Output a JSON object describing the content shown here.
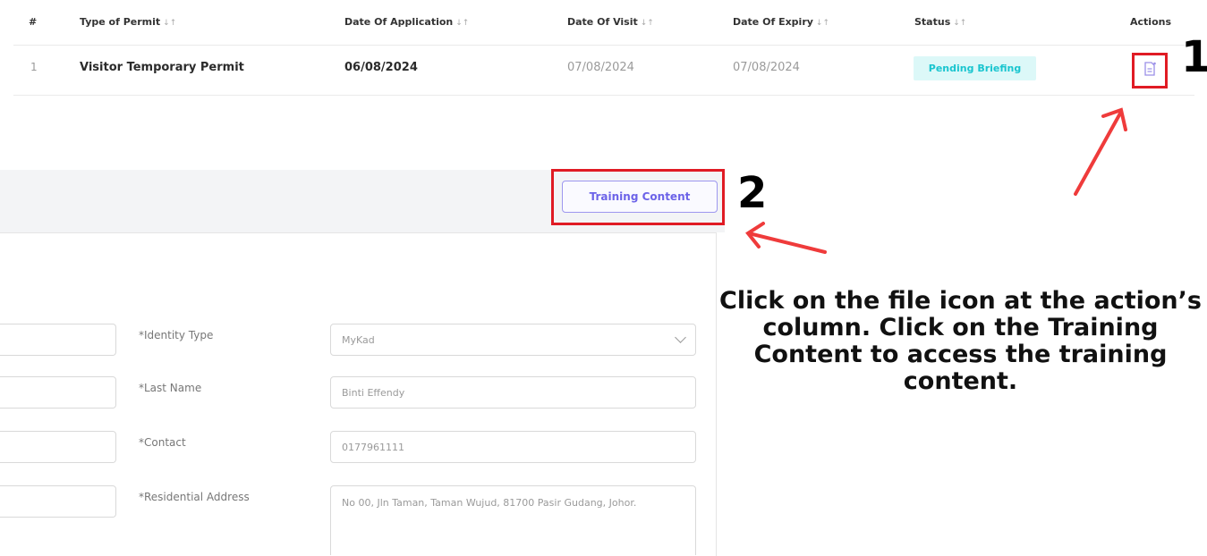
{
  "table": {
    "headers": [
      {
        "label": "#",
        "sort": ""
      },
      {
        "label": "Type of Permit",
        "sort": "↓↑"
      },
      {
        "label": "Date Of Application",
        "sort": "↓↑"
      },
      {
        "label": "Date Of Visit",
        "sort": "↓↑"
      },
      {
        "label": "Date Of Expiry",
        "sort": "↓↑"
      },
      {
        "label": "Status",
        "sort": "↓↑"
      },
      {
        "label": "Actions",
        "sort": ""
      }
    ],
    "rows": [
      {
        "index": "1",
        "type": "Visitor Temporary Permit",
        "application_date": "06/08/2024",
        "visit_date": "07/08/2024",
        "expiry_date": "07/08/2024",
        "status": "Pending Briefing",
        "action_icon": "file-icon"
      }
    ]
  },
  "annotations": {
    "step1": "1",
    "step2": "2",
    "instruction": "Click on the file icon at the action’s column. Click on the Training Content to access the training content.",
    "highlight_color": "#e01b24",
    "arrow_color": "#ef3b3b"
  },
  "form": {
    "training_button": "Training Content",
    "fields": [
      {
        "label": "*Identity Type",
        "value": "MyKad"
      },
      {
        "label": "*Last Name",
        "value": "Binti Effendy"
      },
      {
        "label": "*Contact",
        "value": "0177961111"
      },
      {
        "label": "*Residential Address",
        "value": "No 00, Jln Taman, Taman Wujud, 81700 Pasir Gudang, Johor."
      }
    ]
  },
  "colors": {
    "status_bg": "#dcf8f8",
    "status_text": "#19c5cf",
    "button_accent": "#6c63e8"
  }
}
